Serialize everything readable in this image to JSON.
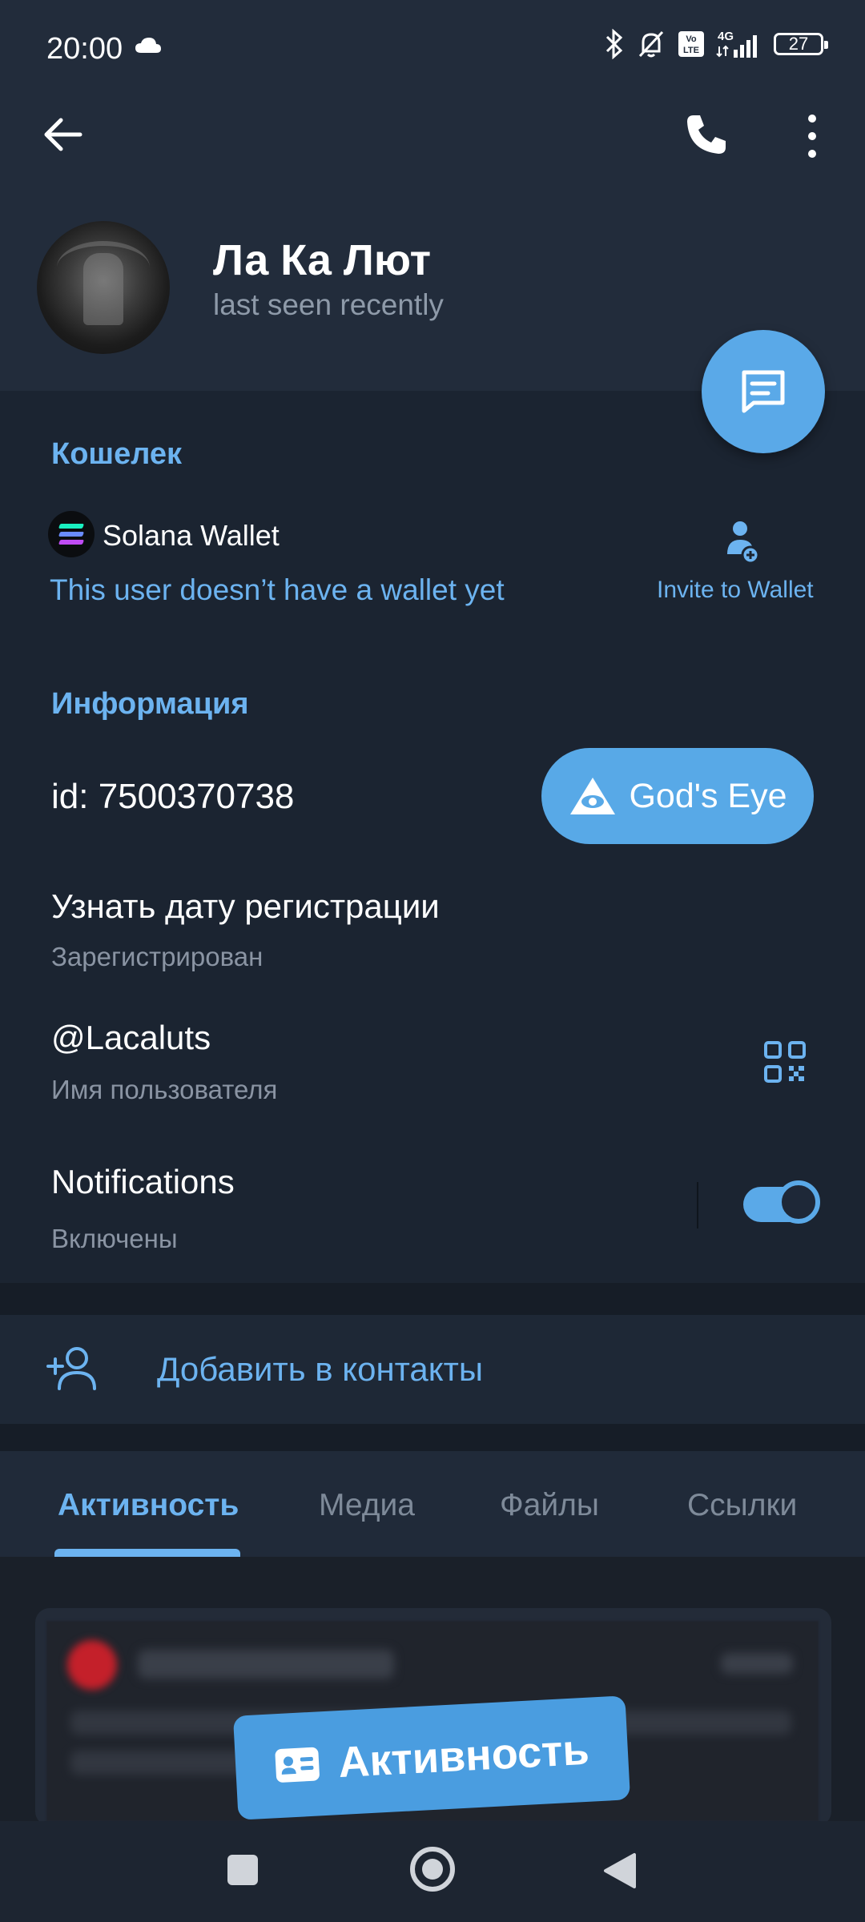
{
  "status_bar": {
    "time": "20:00",
    "battery": "27",
    "network": "4G",
    "volte": "Vo LTE",
    "icons": [
      "cloud-icon",
      "bluetooth-icon",
      "bell-off-icon",
      "volte-icon",
      "signal-icon",
      "battery-icon"
    ]
  },
  "header": {
    "name": "Ла Ка Лют",
    "status": "last seen recently"
  },
  "wallet": {
    "section_title": "Кошелек",
    "wallet_name": "Solana Wallet",
    "empty_text": "This user doesn’t have a wallet yet",
    "invite_label": "Invite to Wallet"
  },
  "info": {
    "section_title": "Информация",
    "id_text": "id: 7500370738",
    "gods_eye_label": "God's Eye",
    "reg_title": "Узнать дату регистрации",
    "reg_sub": "Зарегистрирован",
    "username": "@Lacaluts",
    "username_sub": "Имя пользователя",
    "notifications_title": "Notifications",
    "notifications_sub": "Включены",
    "notifications_on": true
  },
  "actions": {
    "add_contact": "Добавить в контакты"
  },
  "tabs": [
    {
      "label": "Активность",
      "active": true
    },
    {
      "label": "Медиа",
      "active": false
    },
    {
      "label": "Файлы",
      "active": false
    },
    {
      "label": "Ссылки",
      "active": false
    }
  ],
  "activity_badge": "Активность",
  "colors": {
    "background": "#1b2431",
    "header": "#222c3b",
    "accent": "#6cb3f0",
    "button": "#58a9e7"
  }
}
